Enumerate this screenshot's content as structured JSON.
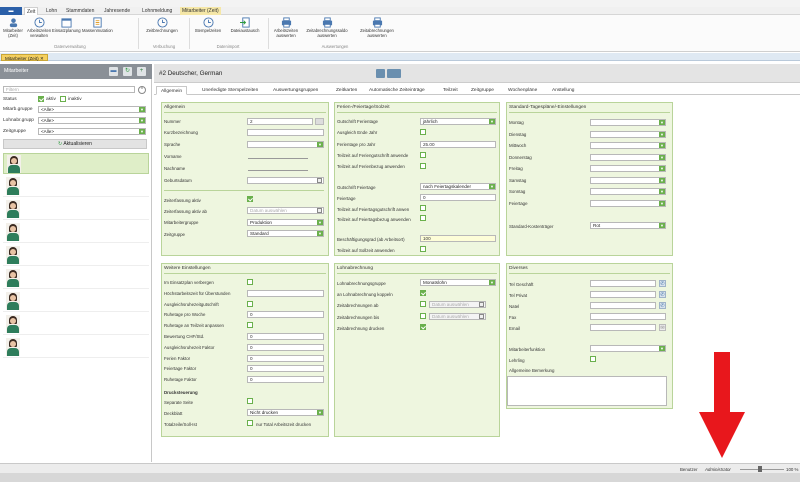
{
  "ribbon": {
    "tabs": [
      "Zeit",
      "Lohn",
      "Stammdaten",
      "Jahresende",
      "Lohnmeldung",
      "Mitarbeiter (Zeit)"
    ],
    "buttons": [
      {
        "label": "Mitarbeiter (Zeit)"
      },
      {
        "label": "Arbeitszeiten verwalten"
      },
      {
        "label": "Einsatzplanung"
      },
      {
        "label": "Massenmutation"
      },
      {
        "label": "Zeitbrechnungen"
      },
      {
        "label": "Stempelzeiten"
      },
      {
        "label": "Dateiaustausch"
      },
      {
        "label": "Arbeitszeiten auswerten"
      },
      {
        "label": "Zeitabrechnungssaldo auswerten"
      },
      {
        "label": "Zeitabrechnungen auswerten"
      }
    ],
    "groups": [
      "Datenverwaltung",
      "Verbuchung",
      "Datenimport",
      "Auswertungen"
    ]
  },
  "doc_tab": "Mitarbeiter (Zeit)",
  "left": {
    "title": "Mitarbeiter",
    "filter_placeholder": "Filtern",
    "status_label": "Status",
    "status_active": "aktiv",
    "status_inactive": "inaktiv",
    "mitarb_gruppe_label": "Mitarb.gruppe",
    "lohnabr_gruppe_label": "Lohnabr.grupp",
    "zeitgruppe_label": "Zeitgruppe",
    "alle": "<Alle>",
    "refresh": "Aktualisieren",
    "employee_count": 9
  },
  "right": {
    "title": "#2 Deutscher, German",
    "tabs": [
      "Allgemein",
      "Unerledigte Stempelzeiten",
      "Auswertungsgruppen",
      "Zeitkarten",
      "Automatische Zeiteinträge",
      "Teilzeit",
      "Zeitgruppe",
      "Wochenpläne",
      "Anstellung"
    ]
  },
  "allgemein": {
    "title": "Allgemein",
    "nummer_label": "Nummer",
    "nummer": "2",
    "kurz_label": "Kurzbezeichnung",
    "sprache_label": "Sprache",
    "vorname_label": "Vorname",
    "nachname_label": "Nachname",
    "geburt_label": "Geburtsdatum",
    "zeiterfassung_label": "Zeiterfassung aktiv",
    "zeiterfassung_ab_label": "Zeiterfassung aktiv ab",
    "datum_placeholder": "Datum auswählen",
    "mitarbeitergruppe_label": "Mitarbeitergruppe",
    "mitarbeitergruppe": "Produktion",
    "zeitgruppe_label": "Zeitgruppe",
    "zeitgruppe": "Standard"
  },
  "ferien": {
    "title": "Ferien-/Feiertage/Solzeit",
    "gutschrift_ferien_label": "Gutschrift Ferientage",
    "gutschrift_ferien": "jährlich",
    "ausgleich_label": "Ausgleich Ende Jahr",
    "ferientage_label": "Ferientage pro Jahr",
    "ferientage": "25.00",
    "teilzeit_ferien_label": "Teilzeit auf Feriengutschrift anwende",
    "teilzeit_bezug_label": "Teilzeit auf Ferienbezug anwenden",
    "gutschrift_feiertage_label": "Gutschrift Feiertage",
    "gutschrift_feiertage": "nach Feiertagskalender",
    "feiertage_label": "Feiertage",
    "feiertage": "0",
    "teilzeit_feiertag_gut_label": "Teilzeit auf Feiertagsgutschrift anwen",
    "teilzeit_feiertag_bezug_label": "Teilzeit auf Feiertagsbezug anwenden",
    "beschaeftigung_label": "Beschäftigungsgrad (ab Arbeitsort)",
    "beschaeftigung": "100",
    "teilzeit_sollzeit_label": "Teilzeit auf Sollzeit anwenden"
  },
  "tagesplaene": {
    "title": "Standard-Tagespläne/-Einstellungen",
    "days": [
      "Montag",
      "Dienstag",
      "Mittwoch",
      "Donnerstag",
      "Freitag",
      "Samstag",
      "Sonntag",
      "Feiertage"
    ],
    "kostentraeger_label": "Standard-Kostenträger",
    "kostentraeger": "Rot"
  },
  "weitere": {
    "title": "Weitere Einstellungen",
    "rows": [
      {
        "label": "Im Einsatzplan verbergen",
        "type": "check"
      },
      {
        "label": "Höchstarbeitszeit für Überstunden",
        "type": "input",
        "value": ""
      },
      {
        "label": "Ausgleichsruhezeitgutschrift",
        "type": "check"
      },
      {
        "label": "Ruhetage pro Woche",
        "type": "input",
        "value": "0"
      },
      {
        "label": "Ruhetage an Teilzeit anpassen",
        "type": "check"
      },
      {
        "label": "Bewertung CHF/Std.",
        "type": "input",
        "value": "0"
      },
      {
        "label": "Ausgleichsruhezeit Faktor",
        "type": "input",
        "value": "0"
      },
      {
        "label": "Ferien Faktor",
        "type": "input",
        "value": "0"
      },
      {
        "label": "Feiertage Faktor",
        "type": "input",
        "value": "0"
      },
      {
        "label": "Ruhetage Faktor",
        "type": "input",
        "value": "0"
      }
    ],
    "drucksteuerung_label": "Drucksteuerung",
    "separate_seite_label": "Separate Seite",
    "deckblatt_label": "Deckblatt",
    "deckblatt": "Nicht drucken",
    "totalzeile_label": "Totalzeile/Soll-Ist",
    "total_arbeitszeit_label": "nur Total Arbeitszeit drucken"
  },
  "lohn": {
    "title": "Lohnabrechnung",
    "gruppe_label": "Lohnabrechnungsgruppe",
    "gruppe": "Monatslohn",
    "koppeln_label": "an Lohnabrechnung koppeln",
    "zeitab_ab_label": "Zeitabrechnungen ab",
    "zeitab_bis_label": "Zeitabrechnungen bis",
    "drucken_label": "Zeitabrechnung drucken",
    "datum_placeholder": "Datum auswählen"
  },
  "diverses": {
    "title": "Diverses",
    "tel_geschaeft_label": "Tel Geschäft",
    "tel_privat_label": "Tel Privat",
    "natel_label": "Natel",
    "fax_label": "Fax",
    "email_label": "Email",
    "mitarbeiterfunktion_label": "Mitarbeiterfunktion",
    "lehrling_label": "Lehrling",
    "bemerkung_label": "Allgemeine Bemerkung"
  },
  "status": {
    "benutzer_label": "Benutzer",
    "benutzer": "Administrator",
    "zoom": "100 %"
  },
  "colors": {
    "accent_green": "#6ab04c",
    "group_bg": "#eef6df",
    "arrow": "#e8171c"
  }
}
